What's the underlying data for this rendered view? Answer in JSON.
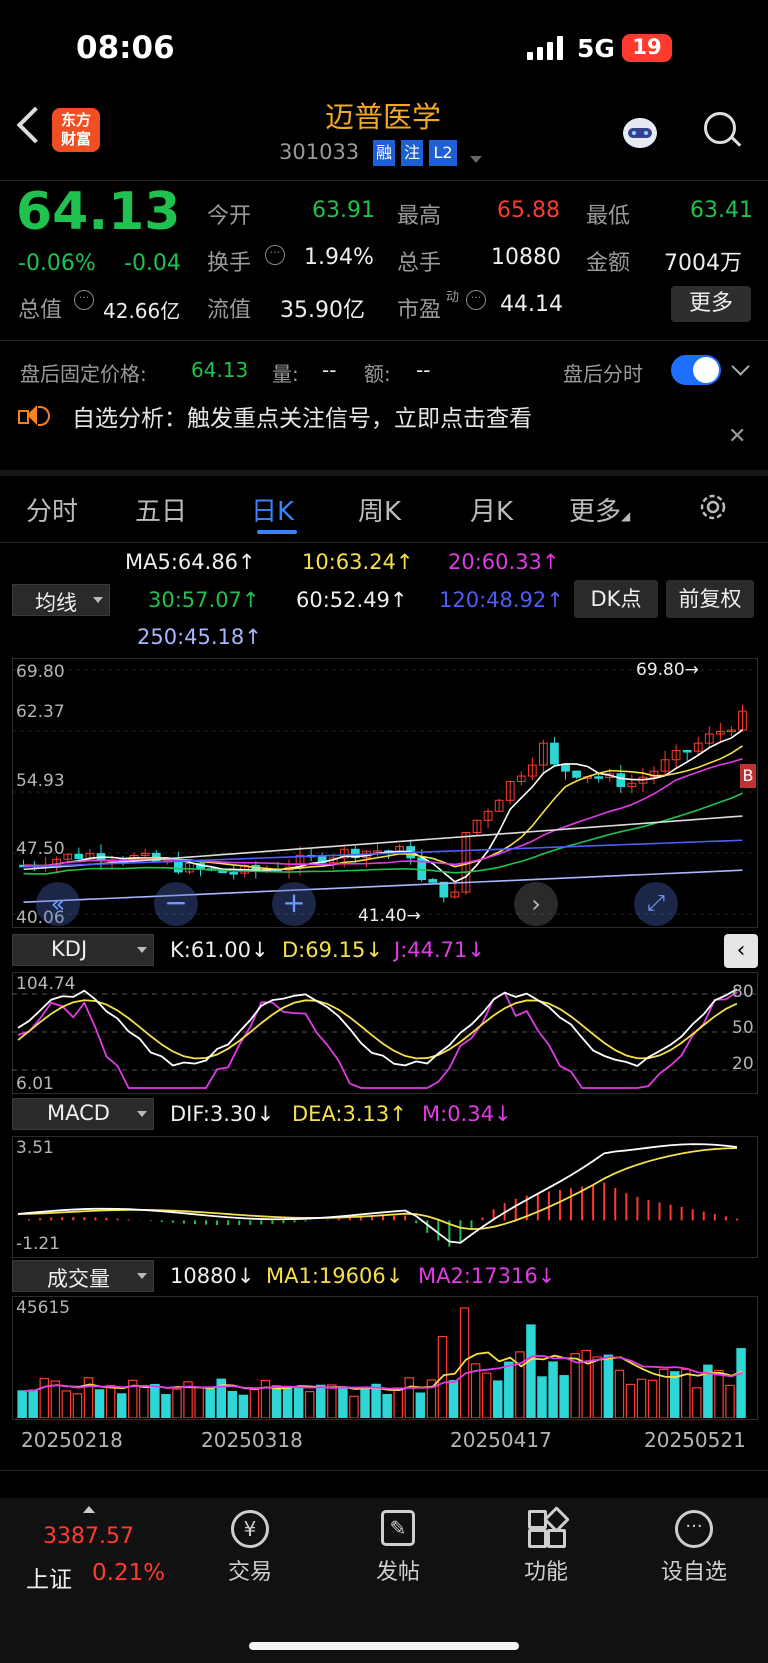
{
  "status": {
    "time": "08:06",
    "network": "5G",
    "battery": "19"
  },
  "header": {
    "title": "迈普医学",
    "code": "301033",
    "badges": [
      "融",
      "注",
      "L2"
    ],
    "logo_line1": "东方",
    "logo_line2": "财富"
  },
  "quote": {
    "price": "64.13",
    "change_pct": "-0.06%",
    "change": "-0.04",
    "open_label": "今开",
    "open": "63.91",
    "high_label": "最高",
    "high": "65.88",
    "low_label": "最低",
    "low": "63.41",
    "turnover_label": "换手",
    "turnover": "1.94%",
    "volume_label": "总手",
    "volume": "10880",
    "amount_label": "金额",
    "amount": "7004万",
    "mktcap_label": "总值",
    "mktcap": "42.66亿",
    "float_label": "流值",
    "float": "35.90亿",
    "pe_label": "市盈",
    "pe_sup": "动",
    "pe": "44.14",
    "more_button": "更多"
  },
  "after_hours": {
    "label": "盘后固定价格:",
    "price": "64.13",
    "vol_label": "量:",
    "vol": "--",
    "amt_label": "额:",
    "amt": "--",
    "toggle_label": "盘后分时",
    "toggle_on": true
  },
  "notice": {
    "text": "自选分析：触发重点关注信号，立即点击查看"
  },
  "tabs": [
    {
      "label": "分时"
    },
    {
      "label": "五日"
    },
    {
      "label": "日K",
      "active": true
    },
    {
      "label": "周K"
    },
    {
      "label": "月K"
    },
    {
      "label": "更多"
    }
  ],
  "ma": {
    "selector": "均线",
    "ma5": "MA5:64.86↑",
    "ma10": "10:63.24↑",
    "ma20": "20:60.33↑",
    "ma30": "30:57.07↑",
    "ma60": "60:52.49↑",
    "ma120": "120:48.92↑",
    "ma250": "250:45.18↑",
    "dk_button": "DK点",
    "adjust_button": "前复权"
  },
  "kline": {
    "ticks": [
      "69.80",
      "62.37",
      "54.93",
      "47.50",
      "40.06"
    ],
    "max_label": "69.80→",
    "min_label": "41.40→",
    "end_marker": "B"
  },
  "kdj": {
    "selector": "KDJ",
    "k": "K:61.00↓",
    "d": "D:69.15↓",
    "j": "J:44.71↓",
    "ticks": [
      "104.74",
      "6.01"
    ],
    "levels": [
      "80",
      "50",
      "20"
    ]
  },
  "macd": {
    "selector": "MACD",
    "dif": "DIF:3.30↓",
    "dea": "DEA:3.13↑",
    "m": "M:0.34↓",
    "ticks": [
      "3.51",
      "-1.21"
    ]
  },
  "volume": {
    "selector": "成交量",
    "value": "10880↓",
    "ma1": "MA1:19606↓",
    "ma2": "MA2:17316↓",
    "tick": "45615"
  },
  "dates": [
    "20250218",
    "20250318",
    "20250417",
    "20250521"
  ],
  "bottom": {
    "index_value": "3387.57",
    "index_name": "上证",
    "index_change": "0.21%",
    "nav": [
      "交易",
      "发帖",
      "功能",
      "设自选"
    ]
  },
  "colors": {
    "up": "#ff3b30",
    "down": "#1fc24e",
    "accent": "#f5821f",
    "toggle": "#1e6fff"
  }
}
